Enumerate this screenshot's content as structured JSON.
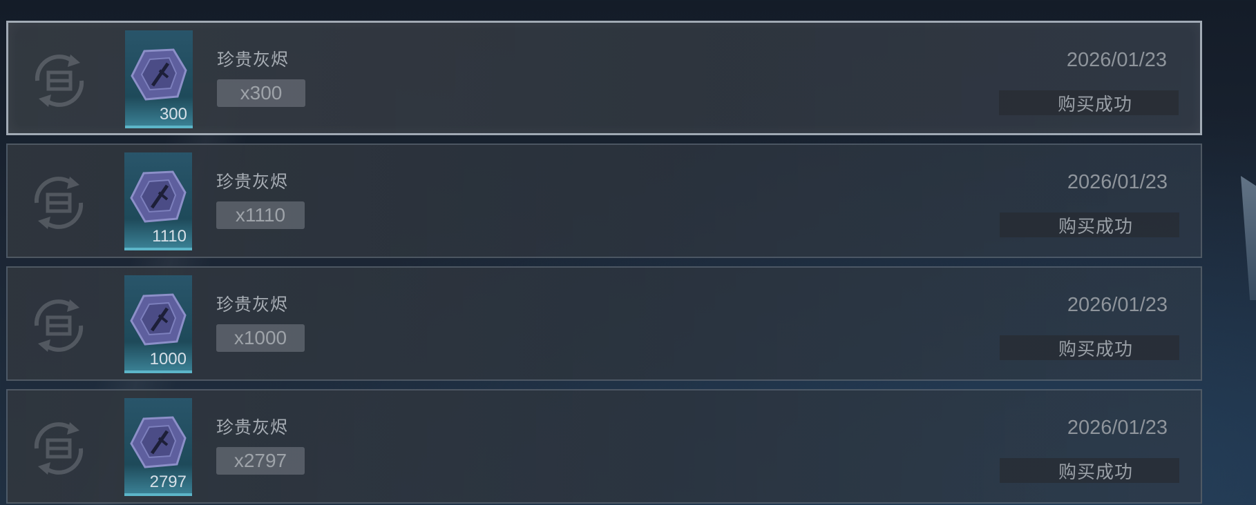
{
  "purchase_history": [
    {
      "item_name": "珍贵灰烬",
      "card_count": "300",
      "quantity": "x300",
      "date": "2026/01/23",
      "status": "购买成功",
      "icon": "gem-icon"
    },
    {
      "item_name": "珍贵灰烬",
      "card_count": "1110",
      "quantity": "x1110",
      "date": "2026/01/23",
      "status": "购买成功",
      "icon": "gem-icon"
    },
    {
      "item_name": "珍贵灰烬",
      "card_count": "1000",
      "quantity": "x1000",
      "date": "2026/01/23",
      "status": "购买成功",
      "icon": "gem-icon"
    },
    {
      "item_name": "珍贵灰烬",
      "card_count": "2797",
      "quantity": "x2797",
      "date": "2026/01/23",
      "status": "购买成功",
      "icon": "gem-icon"
    }
  ],
  "colors": {
    "card_accent": "#5cb5c8",
    "gem": "#5e5f9e"
  }
}
